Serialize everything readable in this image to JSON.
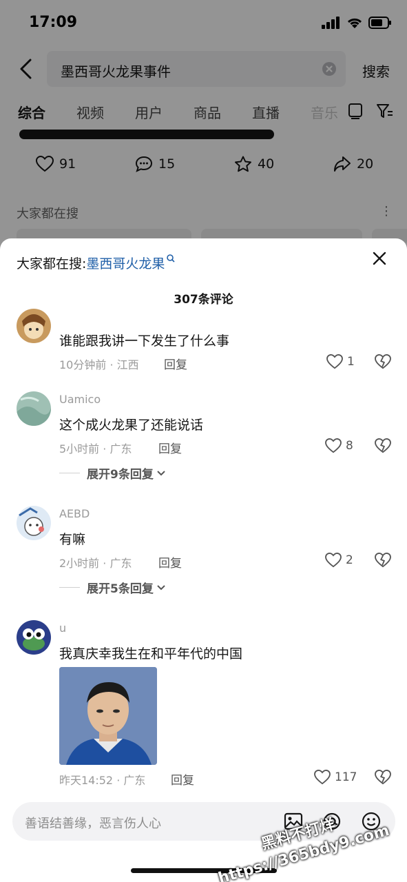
{
  "status_bar": {
    "time": "17:09"
  },
  "search": {
    "query": "墨西哥火龙果事件",
    "button_label": "搜索"
  },
  "tabs": [
    {
      "label": "综合",
      "active": true
    },
    {
      "label": "视频"
    },
    {
      "label": "用户"
    },
    {
      "label": "商品"
    },
    {
      "label": "直播"
    },
    {
      "label": "音乐"
    }
  ],
  "post_stats": {
    "likes": "91",
    "comments": "15",
    "favorites": "40",
    "shares": "20"
  },
  "hot_section": {
    "title": "大家都在搜"
  },
  "sheet": {
    "hot_prefix": "大家都在搜:",
    "hot_query": "墨西哥火龙果",
    "comment_count": "307条评论"
  },
  "comments": [
    {
      "username": "",
      "text": "谁能跟我讲一下发生了什么事",
      "meta": "10分钟前 · 江西",
      "reply_label": "回复",
      "likes": "1"
    },
    {
      "username": "Uamico",
      "text": "这个成火龙果了还能说话",
      "meta": "5小时前 · 广东",
      "reply_label": "回复",
      "likes": "8",
      "expand": "展开9条回复"
    },
    {
      "username": "AEBD",
      "text": "有嘛",
      "meta": "2小时前 · 广东",
      "reply_label": "回复",
      "likes": "2",
      "expand": "展开5条回复"
    },
    {
      "username": "u",
      "text": "我真庆幸我生在和平年代的中国",
      "meta": "昨天14:52 · 广东",
      "reply_label": "回复",
      "likes": "117"
    }
  ],
  "input": {
    "placeholder": "善语结善缘，恶言伤人心"
  },
  "watermark": {
    "line1": "黑料不打烊",
    "line2": "https://365bdy9.com"
  },
  "colors": {
    "accent_link": "#1f5fa8",
    "dim_overlay": "rgba(0,0,0,0.42)"
  }
}
